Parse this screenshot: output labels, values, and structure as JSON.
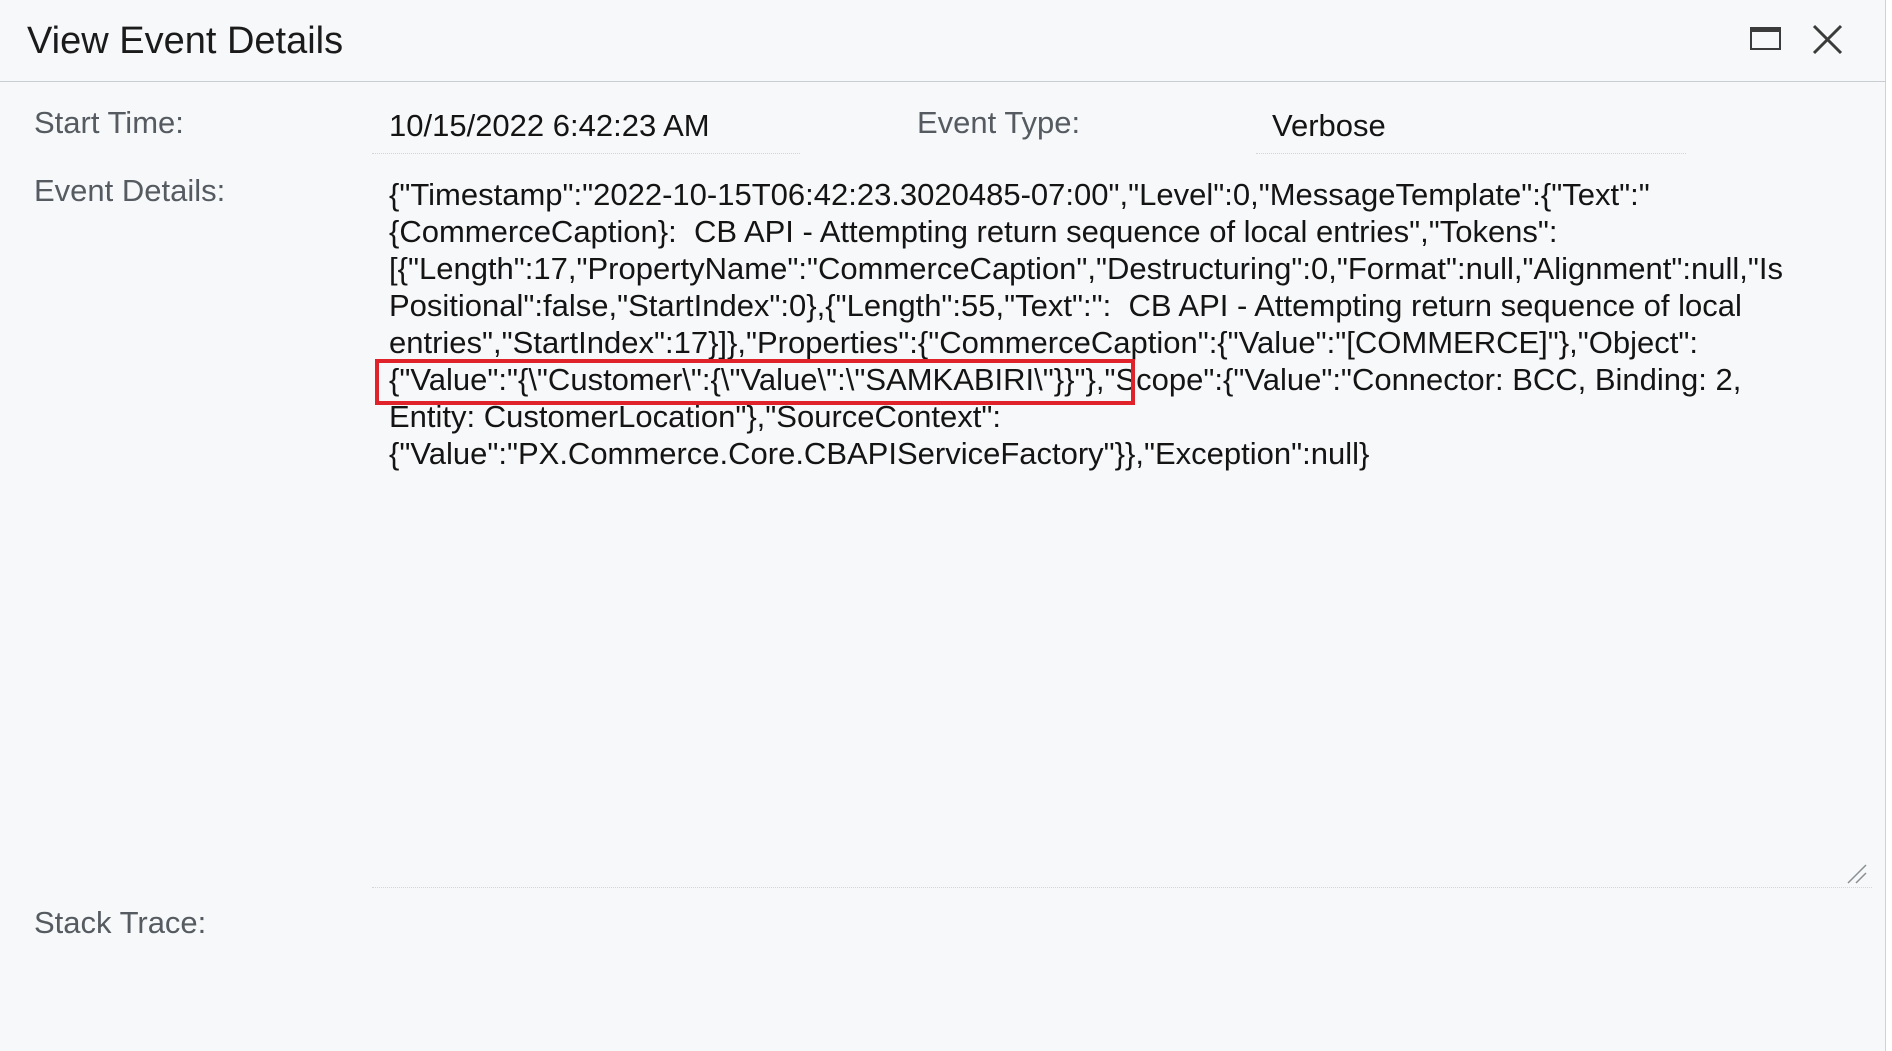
{
  "dialog": {
    "title": "View Event Details"
  },
  "fields": {
    "start_time_label": "Start Time:",
    "start_time_value": "10/15/2022 6:42:23 AM",
    "event_type_label": "Event Type:",
    "event_type_value": "Verbose",
    "event_details_label": "Event Details:",
    "stack_trace_label": "Stack Trace:"
  },
  "event_details_lines": [
    "{\"Timestamp\":\"2022-10-15T06:42:23.3020485-07:00\",\"Level\":0,\"MessageTemplate\":{\"Text\":\"",
    "{CommerceCaption}:  CB API - Attempting return sequence of local entries\",\"Tokens\":",
    "[{\"Length\":17,\"PropertyName\":\"CommerceCaption\",\"Destructuring\":0,\"Format\":null,\"Alignment\":null,\"Is",
    "Positional\":false,\"StartIndex\":0},{\"Length\":55,\"Text\":\":  CB API - Attempting return sequence of local",
    "entries\",\"StartIndex\":17}]},\"Properties\":{\"CommerceCaption\":{\"Value\":\"[COMMERCE]\"},\"Object\":",
    "{\"Value\":\"{\\\"Customer\\\":{\\\"Value\\\":\\\"SAMKABIRI\\\"}}\"},\"Scope\":{\"Value\":\"Connector: BCC, Binding: 2,",
    "Entity: CustomerLocation\"},\"SourceContext\":",
    "{\"Value\":\"PX.Commerce.Core.CBAPIServiceFactory\"}},\"Exception\":null}"
  ],
  "icons": {
    "maximize": "maximize-icon",
    "close": "close-icon",
    "resize": "resize-grip-icon"
  },
  "colors": {
    "highlight": "#e0232b",
    "background": "#f7f8f9",
    "label": "#555b61"
  }
}
